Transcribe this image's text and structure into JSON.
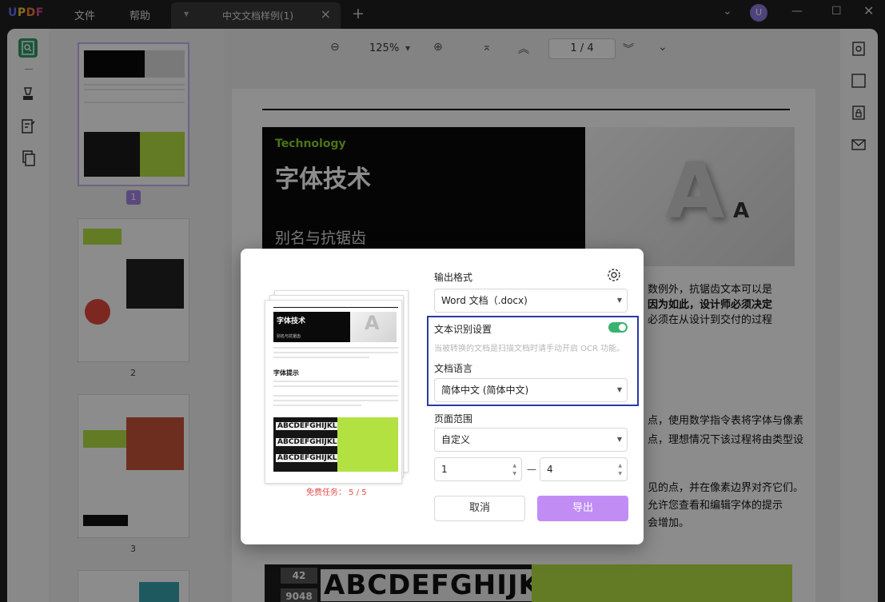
{
  "app": {
    "logo": "UPDF",
    "menu": [
      "文件",
      "帮助"
    ],
    "tab_title": "中文文档样例(1)",
    "avatar_initial": "U"
  },
  "toolbar": {
    "zoom": "125%",
    "page_current": "1",
    "page_total": "4",
    "page_sep": "/"
  },
  "thumbnails": [
    {
      "label": "1"
    },
    {
      "label": "2"
    },
    {
      "label": "3"
    }
  ],
  "document": {
    "hero_tag": "Technology",
    "hero_title": "字体技术",
    "hero_sub": "别名与抗锯齿",
    "letter_big": "A",
    "letter_small": "A",
    "lines": [
      "数例外，抗锯齿文本可以是",
      "因为如此，设计师必须决定",
      "必须在从设计到交付的过程",
      "点，使用数学指令表将字体与像素",
      "点，理想情况下该过程将由类型设",
      "见的点，并在像素边界对齐它们。",
      "允许您查看和编辑字体的提示",
      "会增加。"
    ],
    "bottom_letters": "ABCDEFGHIJKLMNO",
    "bottom_nums": [
      "42",
      "9048"
    ]
  },
  "dialog": {
    "preview": {
      "title": "字体技术",
      "sub": "别名与抗锯齿",
      "subheading": "字体提示",
      "letters": "ABCDEFGHIJKLMNO"
    },
    "free_task": "免费任务：  5 / 5",
    "output_format_label": "输出格式",
    "output_format_value": "Word 文档（.docx)",
    "ocr_label": "文本识别设置",
    "ocr_hint": "当被转换的文档是扫描文档时请手动开启 OCR 功能。",
    "language_label": "文档语言",
    "language_value": "简体中文 (简体中文)",
    "range_label": "页面范围",
    "range_value": "自定义",
    "range_from": "1",
    "range_to": "4",
    "range_dash": "—",
    "cancel": "取消",
    "export": "导出"
  }
}
